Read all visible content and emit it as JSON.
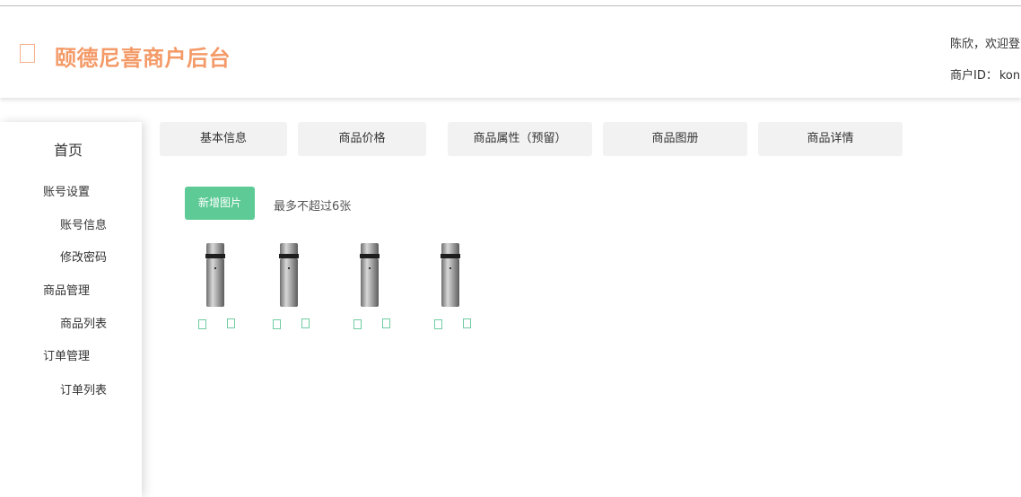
{
  "header": {
    "brand_title": "颐德尼喜商户后台",
    "greeting": "陈欣，欢迎登",
    "merchant_id_label": "商户ID：",
    "merchant_id_value": "kon"
  },
  "sidebar": {
    "home": "首页",
    "sections": [
      {
        "label": "账号设置",
        "items": [
          {
            "label": "账号信息"
          },
          {
            "label": "修改密码"
          }
        ]
      },
      {
        "label": "商品管理",
        "items": [
          {
            "label": "商品列表"
          }
        ]
      },
      {
        "label": "订单管理",
        "items": [
          {
            "label": "订单列表"
          }
        ]
      }
    ]
  },
  "tabs": [
    {
      "label": "基本信息"
    },
    {
      "label": "商品价格"
    },
    {
      "label": "商品属性（预留）"
    },
    {
      "label": "商品图册"
    },
    {
      "label": "商品详情"
    }
  ],
  "gallery": {
    "add_button": "新增图片",
    "limit_note": "最多不超过6张",
    "images": [
      {
        "alt": "thermos-bottle"
      },
      {
        "alt": "thermos-bottle"
      },
      {
        "alt": "thermos-bottle"
      },
      {
        "alt": "thermos-bottle"
      }
    ]
  },
  "colors": {
    "brand": "#f49a68",
    "accent_green": "#5ecb96",
    "tab_bg": "#f2f2f2"
  }
}
